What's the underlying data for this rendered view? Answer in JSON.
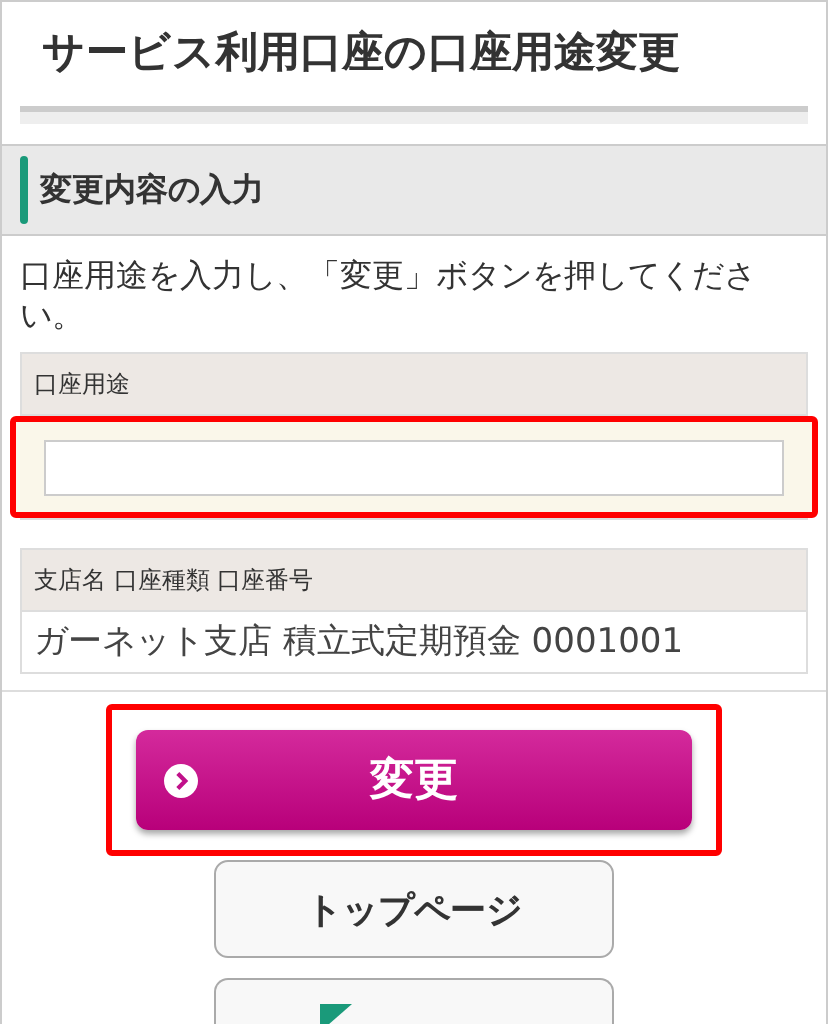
{
  "page_title": "サービス利用口座の口座用途変更",
  "section_title": "変更内容の入力",
  "instruction": "口座用途を入力し、「変更」ボタンを押してください。",
  "purpose_field": {
    "label": "口座用途",
    "highlighted": true
  },
  "account": {
    "label": "支店名 口座種類 口座番号",
    "value": "ガーネット支店 積立式定期預金 0001001"
  },
  "change_button": {
    "label": "変更",
    "highlighted": true
  },
  "top_button": {
    "label": "トップページ"
  }
}
